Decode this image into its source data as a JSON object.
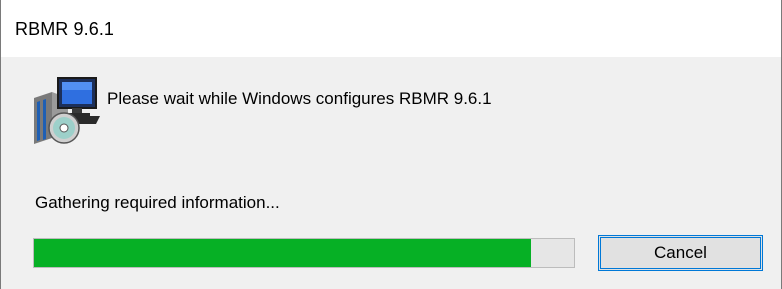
{
  "window": {
    "title": "RBMR 9.6.1"
  },
  "dialog": {
    "icon": "installer-package-icon",
    "message": "Please wait while Windows configures RBMR 9.6.1",
    "status": "Gathering required information...",
    "progress_percent": 92,
    "cancel_label": "Cancel"
  },
  "colors": {
    "progress_fill": "#06b025",
    "accent_border": "#0078d7"
  }
}
